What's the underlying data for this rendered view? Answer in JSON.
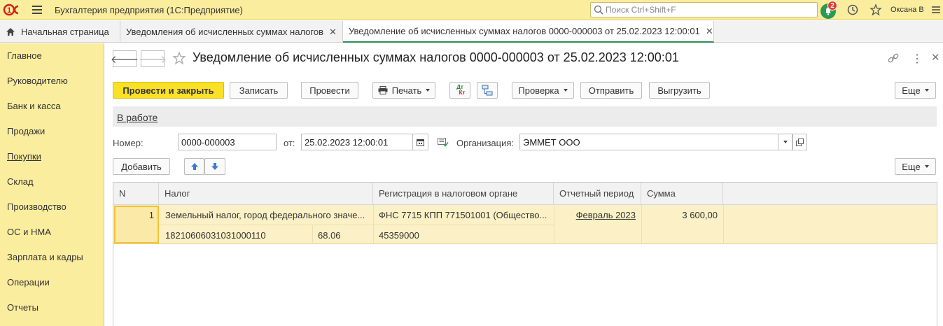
{
  "app": {
    "title": "Бухгалтерия предприятия  (1С:Предприятие)",
    "logo": "1С"
  },
  "search": {
    "placeholder": "Поиск Ctrl+Shift+F"
  },
  "notifications": {
    "count": "2"
  },
  "user": {
    "name": "Оксана В"
  },
  "tabs": [
    {
      "label": "Начальная страница"
    },
    {
      "label": "Уведомления об исчисленных суммах налогов"
    },
    {
      "label": "Уведомление об исчисленных суммах налогов 0000-000003 от 25.02.2023 12:00:01"
    }
  ],
  "sidebar": {
    "items": [
      {
        "label": "Главное"
      },
      {
        "label": "Руководителю"
      },
      {
        "label": "Банк и касса"
      },
      {
        "label": "Продажи"
      },
      {
        "label": "Покупки"
      },
      {
        "label": "Склад"
      },
      {
        "label": "Производство"
      },
      {
        "label": "ОС и НМА"
      },
      {
        "label": "Зарплата и кадры"
      },
      {
        "label": "Операции"
      },
      {
        "label": "Отчеты"
      }
    ]
  },
  "document": {
    "title": "Уведомление об исчисленных суммах налогов 0000-000003 от 25.02.2023 12:00:01",
    "status": "В работе"
  },
  "toolbar": {
    "post_close": "Провести и закрыть",
    "save": "Записать",
    "post": "Провести",
    "print": "Печать",
    "dt_label": "Дт",
    "kt_label": "Кт",
    "check": "Проверка",
    "send": "Отправить",
    "export": "Выгрузить",
    "more": "Еще"
  },
  "form": {
    "number_label": "Номер:",
    "number_value": "0000-000003",
    "date_label": "от:",
    "date_value": "25.02.2023 12:00:01",
    "org_label": "Организация:",
    "org_value": "ЭММЕТ ООО"
  },
  "table_toolbar": {
    "add": "Добавить",
    "more": "Еще"
  },
  "table": {
    "columns": [
      "N",
      "Налог",
      "Регистрация в налоговом органе",
      "Отчетный период",
      "Сумма"
    ],
    "rows": [
      {
        "n": "1",
        "tax": "Земельный налог, город федерального значе...",
        "kbk": "18210606031031000110",
        "code": "68.06",
        "registration": "ФНС 7715 КПП 771501001 (Общество...",
        "oktmo": "45359000",
        "period": "Февраль 2023",
        "sum": "3 600,00"
      }
    ]
  },
  "colors": {
    "accent_yellow": "#fbed9e",
    "primary_button": "#fbe126",
    "bell_green": "#2a9a52",
    "badge_red": "#e53b2d",
    "row_highlight": "#fcf1c6"
  }
}
